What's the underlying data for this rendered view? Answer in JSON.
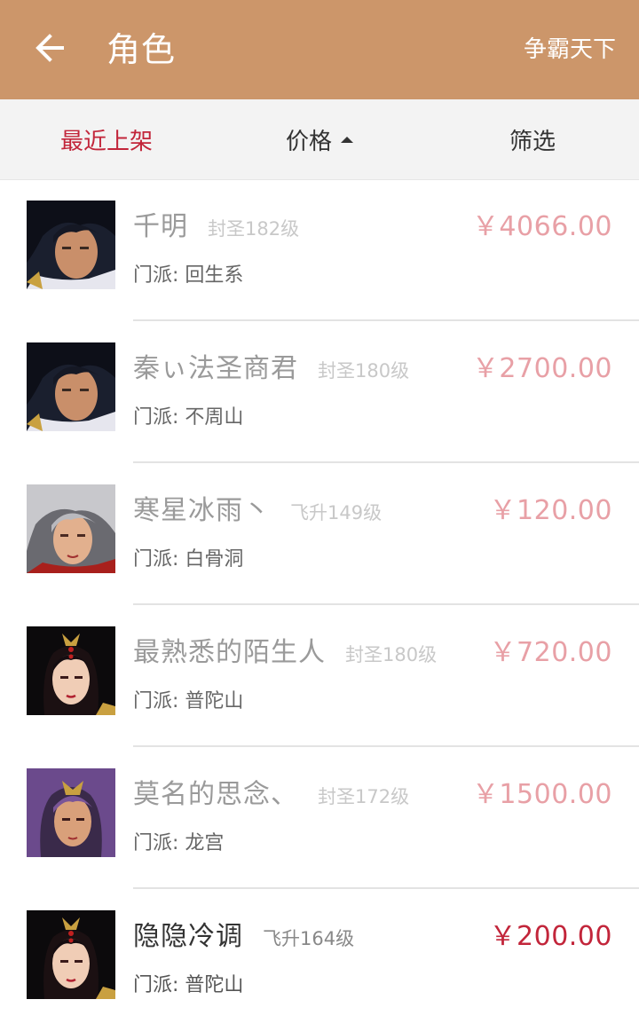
{
  "header": {
    "title": "角色",
    "server": "争霸天下",
    "back_icon": "arrow-left-icon",
    "bg_color": "#cc966a"
  },
  "sort": {
    "tabs": [
      {
        "label": "最近上架",
        "active": true
      },
      {
        "label": "价格",
        "active": false,
        "icon": "sort-ascending-icon"
      },
      {
        "label": "筛选",
        "active": false
      }
    ],
    "active_color": "#c2253a"
  },
  "listings": [
    {
      "name": "千明",
      "level": "封圣182级",
      "price": "￥4066.00",
      "faction": "门派: 回生系",
      "avatar": "male-warrior-portrait"
    },
    {
      "name": "秦ぃ法圣商君",
      "level": "封圣180级",
      "price": "￥2700.00",
      "faction": "门派: 不周山",
      "avatar": "male-warrior-portrait"
    },
    {
      "name": "寒星冰雨丶",
      "level": "飞升149级",
      "price": "￥120.00",
      "faction": "门派: 白骨洞",
      "avatar": "silver-haired-portrait"
    },
    {
      "name": "最熟悉的陌生人",
      "level": "封圣180级",
      "price": "￥720.00",
      "faction": "门派: 普陀山",
      "avatar": "female-portrait"
    },
    {
      "name": "莫名的思念、",
      "level": "封圣172级",
      "price": "￥1500.00",
      "faction": "门派: 龙宫",
      "avatar": "purple-haired-portrait"
    },
    {
      "name": "隐隐冷调",
      "level": "飞升164级",
      "price": "￥200.00",
      "faction": "门派: 普陀山",
      "avatar": "female-portrait"
    }
  ]
}
